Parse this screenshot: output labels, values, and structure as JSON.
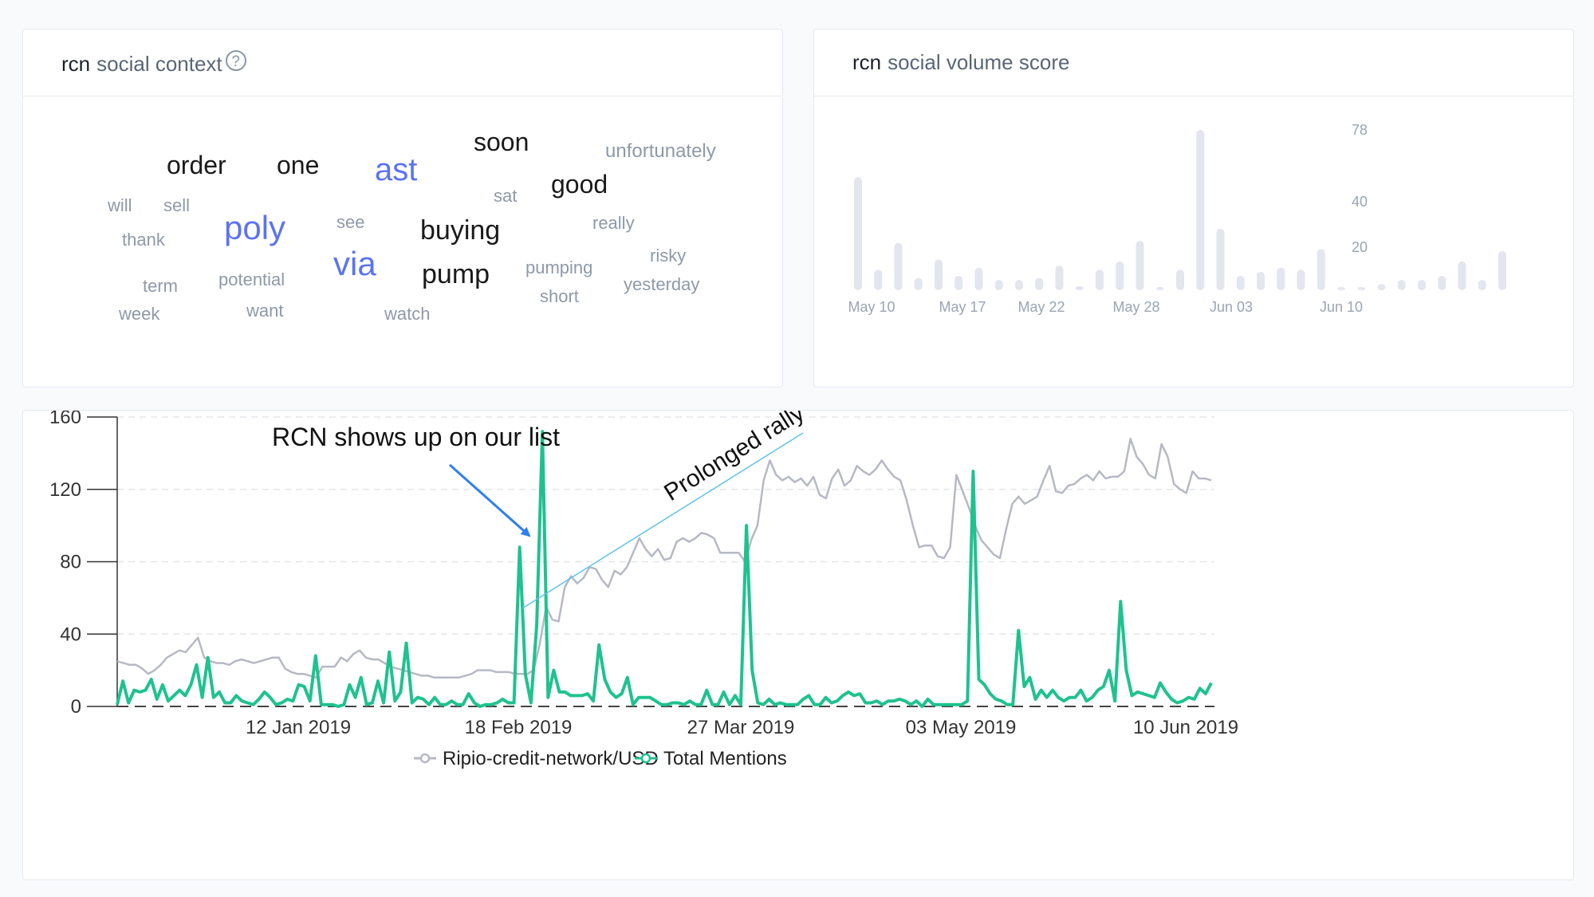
{
  "context_card": {
    "ticker": "rcn",
    "title": "social context",
    "words": [
      {
        "text": "soon",
        "tone": "dark"
      },
      {
        "text": "unfortunately",
        "tone": "light"
      },
      {
        "text": "order",
        "tone": "dark"
      },
      {
        "text": "one",
        "tone": "dark"
      },
      {
        "text": "ast",
        "tone": "accent"
      },
      {
        "text": "good",
        "tone": "dark"
      },
      {
        "text": "sat",
        "tone": "light"
      },
      {
        "text": "will",
        "tone": "light"
      },
      {
        "text": "sell",
        "tone": "light"
      },
      {
        "text": "poly",
        "tone": "accent"
      },
      {
        "text": "see",
        "tone": "light"
      },
      {
        "text": "buying",
        "tone": "dark"
      },
      {
        "text": "really",
        "tone": "light"
      },
      {
        "text": "thank",
        "tone": "light"
      },
      {
        "text": "via",
        "tone": "accent"
      },
      {
        "text": "risky",
        "tone": "light"
      },
      {
        "text": "pump",
        "tone": "dark"
      },
      {
        "text": "pumping",
        "tone": "light"
      },
      {
        "text": "term",
        "tone": "light"
      },
      {
        "text": "potential",
        "tone": "light"
      },
      {
        "text": "yesterday",
        "tone": "light"
      },
      {
        "text": "short",
        "tone": "light"
      },
      {
        "text": "week",
        "tone": "light"
      },
      {
        "text": "want",
        "tone": "light"
      },
      {
        "text": "watch",
        "tone": "light"
      }
    ]
  },
  "volume_card": {
    "ticker": "rcn",
    "title": "social volume score"
  },
  "colors": {
    "dark": "#1a1a1a",
    "light": "#8e99a9",
    "accent": "#5b73f2",
    "teal": "#1fc28f",
    "gray_line": "#b6b9c4",
    "volume_bar": "#e3e6ef",
    "arrow": "#2f7ff0",
    "rally_line": "#5ec3ee"
  },
  "annotations": {
    "list_note": "RCN shows up on our list",
    "rally_note": "Prolonged rally"
  },
  "chart_data": [
    {
      "type": "bar",
      "title": "rcn social volume score",
      "y_ticks": [
        78,
        40,
        20
      ],
      "x_tick_labels": [
        "May 10",
        "May 17",
        "May 22",
        "May 28",
        "Jun 03",
        "Jun 10"
      ],
      "values": [
        55,
        10,
        23,
        6,
        15,
        7,
        11,
        5,
        5,
        6,
        12,
        2,
        10,
        14,
        24,
        1,
        10,
        78,
        30,
        7,
        9,
        11,
        10,
        20,
        0,
        0,
        3,
        5,
        5,
        7,
        14,
        5,
        19
      ]
    },
    {
      "type": "line",
      "x_tick_labels": [
        "12 Jan 2019",
        "18 Feb 2019",
        "27 Mar 2019",
        "03 May 2019",
        "10 Jun 2019"
      ],
      "x_start": "2018-12-14",
      "x_end": "2019-06-10",
      "ylim": [
        0,
        160
      ],
      "y_ticks": [
        0,
        40,
        80,
        120,
        160
      ],
      "grid": true,
      "legend": "bottom-center",
      "series": [
        {
          "name": "Ripio-credit-network/USD",
          "values": [
            25,
            24,
            23,
            23,
            21,
            18,
            20,
            23,
            27,
            29,
            31,
            30,
            34,
            38,
            27,
            25,
            24,
            24,
            23,
            25,
            26,
            25,
            24,
            25,
            26,
            27,
            27,
            21,
            19,
            18,
            18,
            17,
            16,
            22,
            22,
            22,
            27,
            25,
            29,
            31,
            27,
            26,
            26,
            24,
            22,
            21,
            20,
            19,
            18,
            17,
            17,
            16,
            16,
            16,
            16,
            16,
            17,
            18,
            20,
            20,
            20,
            19,
            19,
            19,
            18,
            18,
            18,
            20,
            35,
            55,
            48,
            47,
            66,
            72,
            68,
            71,
            77,
            76,
            70,
            66,
            75,
            73,
            77,
            85,
            93,
            87,
            83,
            87,
            81,
            82,
            91,
            93,
            91,
            93,
            96,
            95,
            93,
            85,
            85,
            85,
            85,
            80,
            92,
            100,
            125,
            136,
            128,
            125,
            127,
            124,
            126,
            122,
            127,
            117,
            115,
            126,
            131,
            122,
            125,
            133,
            130,
            128,
            131,
            136,
            131,
            127,
            125,
            114,
            100,
            88,
            89,
            89,
            83,
            82,
            88,
            128,
            119,
            110,
            100,
            92,
            88,
            84,
            82,
            98,
            112,
            116,
            112,
            114,
            116,
            125,
            133,
            119,
            118,
            122,
            123,
            126,
            128,
            125,
            130,
            126,
            127,
            127,
            130,
            148,
            138,
            134,
            128,
            126,
            145,
            138,
            123,
            120,
            118,
            130,
            126,
            126,
            125
          ]
        },
        {
          "name": "Total Mentions",
          "values": [
            1,
            14,
            2,
            9,
            8,
            9,
            15,
            4,
            12,
            3,
            6,
            9,
            6,
            12,
            23,
            5,
            27,
            5,
            8,
            2,
            2,
            6,
            3,
            2,
            1,
            4,
            8,
            5,
            1,
            2,
            4,
            3,
            12,
            11,
            3,
            28,
            1,
            1,
            1,
            0,
            1,
            12,
            5,
            16,
            1,
            2,
            14,
            2,
            30,
            3,
            8,
            35,
            2,
            5,
            4,
            1,
            5,
            1,
            1,
            3,
            1,
            1,
            7,
            2,
            0,
            1,
            1,
            2,
            4,
            2,
            2,
            88,
            18,
            2,
            45,
            152,
            5,
            20,
            8,
            8,
            6,
            6,
            6,
            7,
            3,
            34,
            15,
            8,
            5,
            7,
            16,
            1,
            5,
            5,
            5,
            3,
            1,
            1,
            2,
            2,
            1,
            3,
            1,
            1,
            9,
            1,
            1,
            8,
            1,
            6,
            1,
            100,
            20,
            2,
            1,
            4,
            1,
            2,
            1,
            1,
            1,
            4,
            6,
            1,
            1,
            5,
            2,
            3,
            6,
            8,
            6,
            7,
            2,
            2,
            3,
            1,
            3,
            3,
            4,
            3,
            1,
            3,
            0,
            4,
            1,
            1,
            1,
            1,
            1,
            1,
            3,
            130,
            15,
            12,
            7,
            4,
            3,
            1,
            1,
            42,
            11,
            16,
            4,
            9,
            5,
            9,
            5,
            3,
            5,
            5,
            9,
            3,
            5,
            9,
            11,
            20,
            3,
            58,
            20,
            6,
            8,
            7,
            6,
            5,
            13,
            8,
            4,
            2,
            3,
            5,
            4,
            10,
            7,
            13
          ]
        }
      ]
    }
  ]
}
